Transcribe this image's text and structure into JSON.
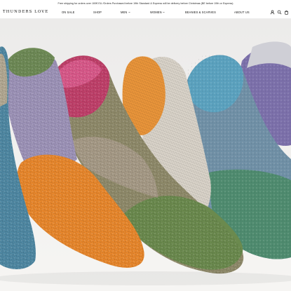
{
  "announcement": {
    "text": "Free shipping for orders over 100€ EU /Orders Purchased before 19th Standard & Express will be delivery before Christmas (BE before 19th or Express)"
  },
  "header": {
    "logo": "THUNDERS LOVE",
    "nav": {
      "on_sale": "ON SALE",
      "shop": "SHOP",
      "men": "MEN",
      "women": "WOMEN",
      "beanies": "BEANIES & SCARVES",
      "about": "ABOUT US"
    },
    "icons": [
      "account-icon",
      "search-icon",
      "cart-icon"
    ]
  },
  "hero": {
    "image": "colorful-knitted-socks-photo",
    "colors": {
      "background": "#f1f0ee",
      "orange": "#e88a2e",
      "teal": "#4a8fa8",
      "green": "#5f7d4a",
      "purple": "#7a6aa8",
      "pink": "#c8386a",
      "oatmeal": "#b9a996"
    }
  }
}
